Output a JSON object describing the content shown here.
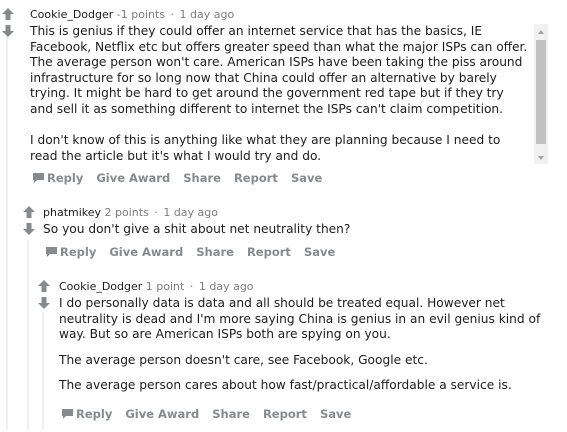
{
  "colors": {
    "text": "#1c1c1c",
    "meta": "#7c7c7c",
    "action": "#878a8c",
    "thread_line": "#edeff1",
    "arrow": "#878a8c"
  },
  "icons": {
    "upvote": "upvote-arrow-icon",
    "downvote": "downvote-arrow-icon",
    "reply": "speech-bubble-icon",
    "scroll_up": "chevron-up-icon",
    "scroll_down": "chevron-down-icon"
  },
  "comments": [
    {
      "author": "Cookie_Dodger",
      "points": "-1 points",
      "dot": "·",
      "time": "1 day ago",
      "paragraphs": [
        "This is genius if they could offer an internet service that has the basics, IE Facebook, Netflix etc but offers greater speed than what the major ISPs can offer. The average person won't care. American ISPs have been taking the piss around infrastructure for so long now that China could offer an alternative by barely trying. It might be hard to get around the government red tape but if they try and sell it as something different to internet the ISPs can't claim competition.",
        "I don't know of this is anything like what they are planning because I need to read the article but it's what I would try and do."
      ],
      "actions": {
        "reply": "Reply",
        "give_award": "Give Award",
        "share": "Share",
        "report": "Report",
        "save": "Save"
      }
    },
    {
      "author": "phatmikey",
      "points": "2 points",
      "dot": "·",
      "time": "1 day ago",
      "paragraphs": [
        "So you don't give a shit about net neutrality then?"
      ],
      "actions": {
        "reply": "Reply",
        "give_award": "Give Award",
        "share": "Share",
        "report": "Report",
        "save": "Save"
      }
    },
    {
      "author": "Cookie_Dodger",
      "points": "1 point",
      "dot": "·",
      "time": "1 day ago",
      "paragraphs": [
        "I do personally data is data and all should be treated equal. However net neutrality is dead and I'm more saying China is genius in an evil genius kind of way. But so are American ISPs both are spying on you.",
        "The average person doesn't care, see Facebook, Google etc.",
        "The average person cares about how fast/practical/affordable a service is."
      ],
      "actions": {
        "reply": "Reply",
        "give_award": "Give Award",
        "share": "Share",
        "report": "Report",
        "save": "Save"
      }
    }
  ]
}
